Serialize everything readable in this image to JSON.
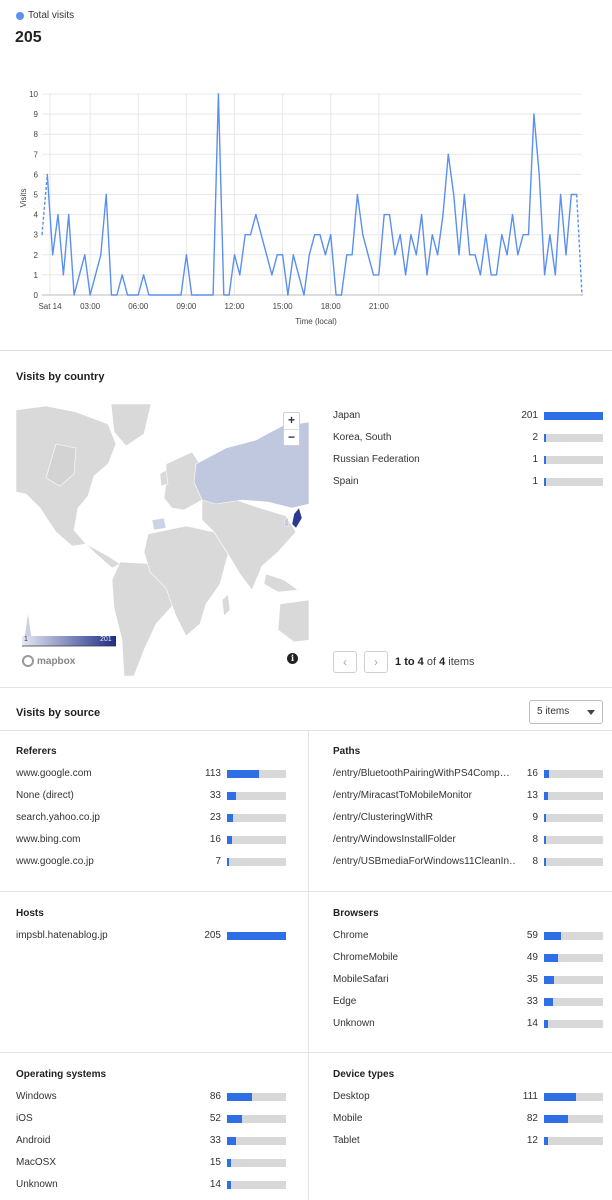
{
  "header": {
    "legend_label": "Total visits",
    "total": "205",
    "legend_color": "#5b8ff0"
  },
  "chart_data": {
    "type": "line",
    "title": "",
    "xlabel": "Time (local)",
    "ylabel": "Visits",
    "ylim": [
      0,
      10
    ],
    "yticks": [
      "0",
      "1",
      "2",
      "3",
      "4",
      "5",
      "6",
      "7",
      "8",
      "9",
      "10"
    ],
    "xtick_labels": [
      "Sat 14",
      "03:00",
      "06:00",
      "09:00",
      "12:00",
      "15:00",
      "18:00",
      "21:00"
    ],
    "xtick_hours": [
      0.5,
      3,
      6,
      9,
      12,
      15,
      18,
      21
    ],
    "x_interval_minutes": 20,
    "series": [
      {
        "color": "#5b8ff0",
        "values": [
          3,
          6,
          2,
          4,
          1,
          4,
          0,
          1,
          2,
          0,
          1,
          2,
          5,
          0,
          0,
          1,
          0,
          0,
          0,
          1,
          0,
          0,
          0,
          0,
          0,
          0,
          0,
          2,
          0,
          0,
          0,
          0,
          0,
          10,
          0,
          0,
          2,
          1,
          3,
          3,
          4,
          3,
          2,
          1,
          2,
          2,
          0,
          2,
          1,
          0,
          2,
          3,
          3,
          2,
          3,
          0,
          0,
          2,
          2,
          5,
          3,
          2,
          1,
          1,
          4,
          4,
          2,
          3,
          1,
          3,
          2,
          4,
          1,
          3,
          2,
          4,
          7,
          5,
          2,
          5,
          2,
          2,
          1,
          3,
          1,
          1,
          3,
          2,
          4,
          2,
          3,
          3,
          9,
          6,
          1,
          3,
          1,
          5,
          2,
          5,
          5,
          0
        ]
      }
    ]
  },
  "countries_section": {
    "title": "Visits by country",
    "rows": [
      {
        "label": "Japan",
        "value": "201",
        "fraction": 1.0
      },
      {
        "label": "Korea, South",
        "value": "2",
        "fraction": 0.01
      },
      {
        "label": "Russian Federation",
        "value": "1",
        "fraction": 0.005
      },
      {
        "label": "Spain",
        "value": "1",
        "fraction": 0.005
      }
    ],
    "pagination": {
      "prev": "‹",
      "next": "›",
      "from": "1",
      "to_word": "to",
      "to": "4",
      "of_word": "of",
      "total": "4",
      "items_word": "items"
    },
    "map": {
      "zoom_in": "+",
      "zoom_out": "−",
      "scale_min": "1",
      "scale_max": "201",
      "logo": "mapbox",
      "info": "i",
      "japan_color": "#2a3a8f",
      "russia_color": "#c0c8e0",
      "land_color": "#d9d9d9"
    }
  },
  "source_section": {
    "title": "Visits by source",
    "select_value": "5 items"
  },
  "referers": {
    "title": "Referers",
    "rows": [
      {
        "label": "www.google.com",
        "value": "113",
        "fraction": 0.55
      },
      {
        "label": "None (direct)",
        "value": "33",
        "fraction": 0.16
      },
      {
        "label": "search.yahoo.co.jp",
        "value": "23",
        "fraction": 0.11
      },
      {
        "label": "www.bing.com",
        "value": "16",
        "fraction": 0.08
      },
      {
        "label": "www.google.co.jp",
        "value": "7",
        "fraction": 0.03
      }
    ]
  },
  "paths": {
    "title": "Paths",
    "rows": [
      {
        "label": "/entry/BluetoothPairingWithPS4Comp…",
        "value": "16",
        "fraction": 0.08
      },
      {
        "label": "/entry/MiracastToMobileMonitor",
        "value": "13",
        "fraction": 0.06
      },
      {
        "label": "/entry/ClusteringWithR",
        "value": "9",
        "fraction": 0.04
      },
      {
        "label": "/entry/WindowsInstallFolder",
        "value": "8",
        "fraction": 0.04
      },
      {
        "label": "/entry/USBmediaForWindows11CleanIn…",
        "value": "8",
        "fraction": 0.04
      }
    ]
  },
  "hosts": {
    "title": "Hosts",
    "rows": [
      {
        "label": "impsbl.hatenablog.jp",
        "value": "205",
        "fraction": 1.0
      }
    ]
  },
  "browsers": {
    "title": "Browsers",
    "rows": [
      {
        "label": "Chrome",
        "value": "59",
        "fraction": 0.29
      },
      {
        "label": "ChromeMobile",
        "value": "49",
        "fraction": 0.24
      },
      {
        "label": "MobileSafari",
        "value": "35",
        "fraction": 0.17
      },
      {
        "label": "Edge",
        "value": "33",
        "fraction": 0.16
      },
      {
        "label": "Unknown",
        "value": "14",
        "fraction": 0.07
      }
    ]
  },
  "os": {
    "title": "Operating systems",
    "rows": [
      {
        "label": "Windows",
        "value": "86",
        "fraction": 0.42
      },
      {
        "label": "iOS",
        "value": "52",
        "fraction": 0.25
      },
      {
        "label": "Android",
        "value": "33",
        "fraction": 0.16
      },
      {
        "label": "MacOSX",
        "value": "15",
        "fraction": 0.07
      },
      {
        "label": "Unknown",
        "value": "14",
        "fraction": 0.07
      }
    ]
  },
  "devices": {
    "title": "Device types",
    "rows": [
      {
        "label": "Desktop",
        "value": "111",
        "fraction": 0.54
      },
      {
        "label": "Mobile",
        "value": "82",
        "fraction": 0.4
      },
      {
        "label": "Tablet",
        "value": "12",
        "fraction": 0.06
      }
    ]
  }
}
